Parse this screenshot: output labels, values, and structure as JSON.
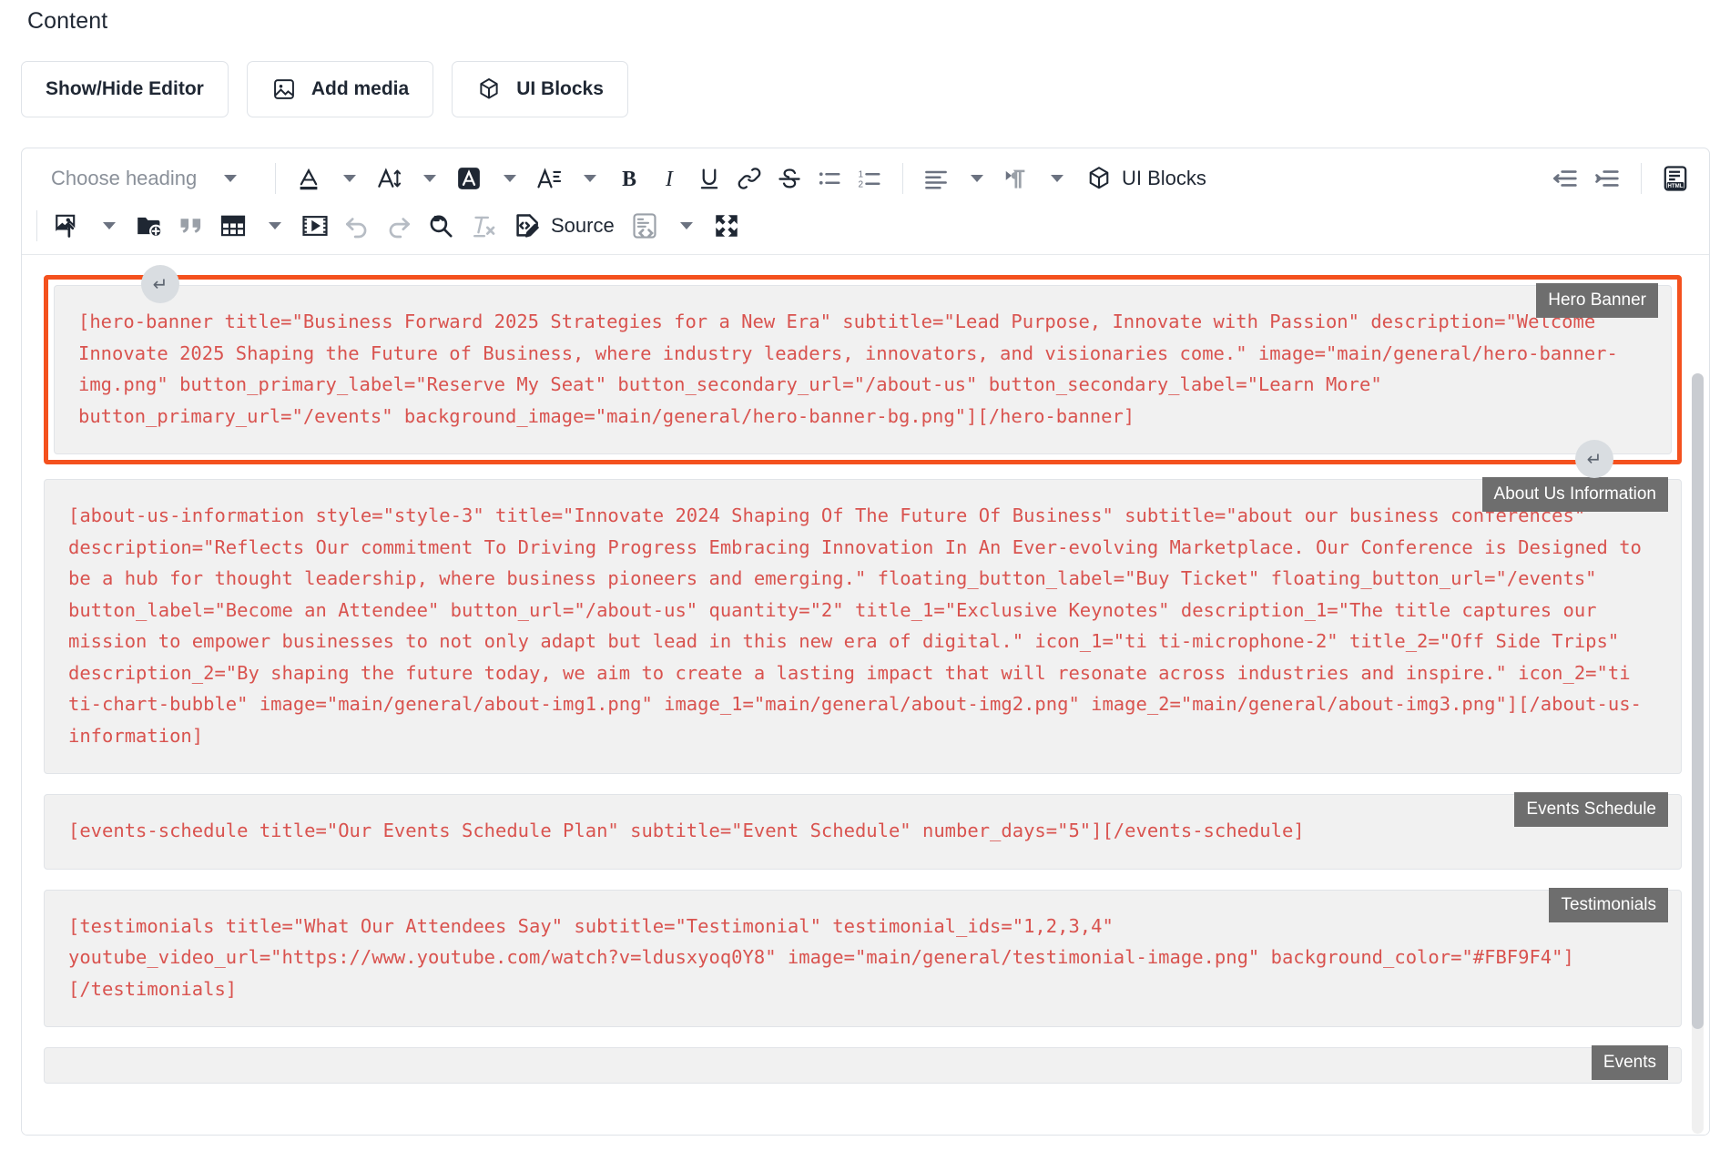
{
  "page": {
    "section_label": "Content"
  },
  "top_buttons": [
    {
      "label": "Show/Hide Editor",
      "icon": null
    },
    {
      "label": "Add media",
      "icon": "image-icon"
    },
    {
      "label": "UI Blocks",
      "icon": "cube-icon"
    }
  ],
  "toolbar": {
    "heading_select": {
      "value": "Choose heading",
      "icon": "chevron-down-icon"
    },
    "row1": [
      {
        "name": "font-color",
        "icon": "text-color-icon",
        "has_chevron": true
      },
      {
        "name": "font-size",
        "icon": "font-size-icon",
        "has_chevron": true
      },
      {
        "name": "background-color",
        "icon": "highlight-color-icon",
        "has_chevron": true
      },
      {
        "name": "font-family",
        "icon": "font-family-icon",
        "has_chevron": true
      },
      {
        "name": "bold",
        "icon": "bold-icon",
        "has_chevron": false
      },
      {
        "name": "italic",
        "icon": "italic-icon",
        "has_chevron": false
      },
      {
        "name": "underline",
        "icon": "underline-icon",
        "has_chevron": false
      },
      {
        "name": "link",
        "icon": "link-icon",
        "has_chevron": false
      },
      {
        "name": "strikethrough",
        "icon": "strikethrough-icon",
        "has_chevron": false
      },
      {
        "name": "bulleted-list",
        "icon": "bulleted-list-icon",
        "has_chevron": false
      },
      {
        "name": "numbered-list",
        "icon": "numbered-list-icon",
        "has_chevron": false
      },
      {
        "name": "align",
        "icon": "align-left-icon",
        "has_chevron": true
      },
      {
        "name": "text-direction",
        "icon": "paragraph-direction-icon",
        "has_chevron": true
      },
      {
        "name": "ui-blocks",
        "icon": "cube-icon",
        "label": "UI Blocks",
        "has_chevron": false
      },
      {
        "name": "outdent",
        "icon": "outdent-icon",
        "has_chevron": false
      },
      {
        "name": "indent",
        "icon": "indent-icon",
        "has_chevron": false
      },
      {
        "name": "html-snippet",
        "icon": "html-icon",
        "has_chevron": false
      }
    ],
    "row2": [
      {
        "name": "insert-image",
        "icon": "image-upload-icon",
        "has_chevron": true
      },
      {
        "name": "file-manager",
        "icon": "folder-add-icon",
        "has_chevron": false
      },
      {
        "name": "blockquote",
        "icon": "quote-icon",
        "has_chevron": false
      },
      {
        "name": "insert-table",
        "icon": "table-icon",
        "has_chevron": true
      },
      {
        "name": "insert-video",
        "icon": "video-icon",
        "has_chevron": false
      },
      {
        "name": "undo",
        "icon": "undo-icon",
        "has_chevron": false
      },
      {
        "name": "redo",
        "icon": "redo-icon",
        "has_chevron": false
      },
      {
        "name": "find-replace",
        "icon": "find-replace-icon",
        "has_chevron": false
      },
      {
        "name": "remove-format",
        "icon": "remove-format-icon",
        "has_chevron": false
      },
      {
        "name": "source-editing",
        "icon": "source-edit-icon",
        "label": "Source",
        "has_chevron": false
      },
      {
        "name": "code-block",
        "icon": "code-block-icon",
        "has_chevron": true
      },
      {
        "name": "fullscreen",
        "icon": "fullscreen-icon",
        "has_chevron": false
      }
    ]
  },
  "colors": {
    "selection_outline": "#F4511E",
    "shortcode_text": "#D9534F",
    "block_background": "#F1F1F1",
    "tag_background": "#6E6E6E"
  },
  "blocks": [
    {
      "tag": "Hero Banner",
      "selected": true,
      "code": "[hero-banner title=\"Business Forward 2025 Strategies for a New Era\" subtitle=\"Lead Purpose, Innovate with Passion\" description=\"Welcome Innovate 2025 Shaping the Future of Business, where industry leaders, innovators, and visionaries come.\" image=\"main/general/hero-banner-img.png\" button_primary_label=\"Reserve My Seat\" button_secondary_url=\"/about-us\" button_secondary_label=\"Learn More\" button_primary_url=\"/events\" background_image=\"main/general/hero-banner-bg.png\"][/hero-banner]"
    },
    {
      "tag": "About Us Information",
      "selected": false,
      "code": "[about-us-information style=\"style-3\" title=\"Innovate 2024 Shaping Of The Future Of Business\" subtitle=\"about our business conferences\" description=\"Reflects Our commitment To Driving Progress Embracing Innovation In An Ever-evolving Marketplace. Our Conference is Designed to be a hub for thought leadership, where business pioneers and emerging.\" floating_button_label=\"Buy Ticket\" floating_button_url=\"/events\" button_label=\"Become an Attendee\" button_url=\"/about-us\" quantity=\"2\" title_1=\"Exclusive Keynotes\" description_1=\"The title captures our mission to empower businesses to not only adapt but lead in this new era of digital.\" icon_1=\"ti ti-microphone-2\" title_2=\"Off Side Trips\" description_2=\"By shaping the future today, we aim to create a lasting impact that will resonate across industries and inspire.\" icon_2=\"ti ti-chart-bubble\" image=\"main/general/about-img1.png\" image_1=\"main/general/about-img2.png\" image_2=\"main/general/about-img3.png\"][/about-us-information]"
    },
    {
      "tag": "Events Schedule",
      "selected": false,
      "code": "[events-schedule title=\"Our Events Schedule Plan\" subtitle=\"Event Schedule\" number_days=\"5\"][/events-schedule]"
    },
    {
      "tag": "Testimonials",
      "selected": false,
      "code": "[testimonials title=\"What Our Attendees Say\" subtitle=\"Testimonial\" testimonial_ids=\"1,2,3,4\" youtube_video_url=\"https://www.youtube.com/watch?v=ldusxyoq0Y8\" image=\"main/general/testimonial-image.png\" background_color=\"#FBF9F4\"][/testimonials]"
    },
    {
      "tag": "Events",
      "selected": false,
      "code": ""
    }
  ]
}
